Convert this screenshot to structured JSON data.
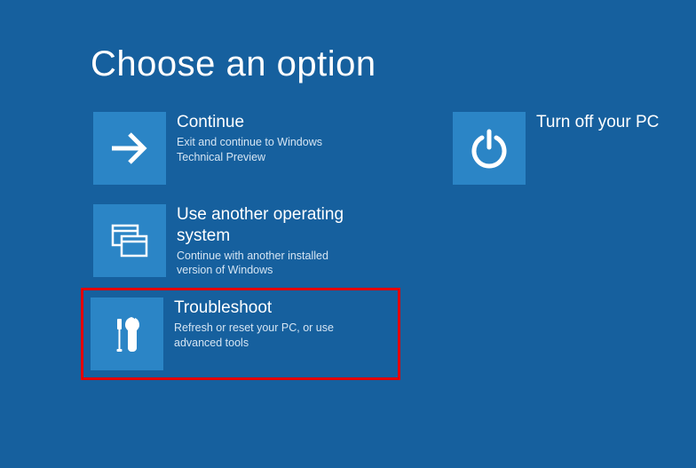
{
  "page": {
    "title": "Choose an option"
  },
  "options": {
    "continue": {
      "title": "Continue",
      "desc": "Exit and continue to Windows Technical Preview"
    },
    "useAnother": {
      "title": "Use another operating system",
      "desc": "Continue with another installed version of Windows"
    },
    "troubleshoot": {
      "title": "Troubleshoot",
      "desc": "Refresh or reset your PC, or use advanced tools"
    },
    "turnOff": {
      "title": "Turn off your PC",
      "desc": ""
    }
  },
  "colors": {
    "background": "#16609e",
    "tile": "#2b85c6",
    "highlight": "#e40000"
  }
}
